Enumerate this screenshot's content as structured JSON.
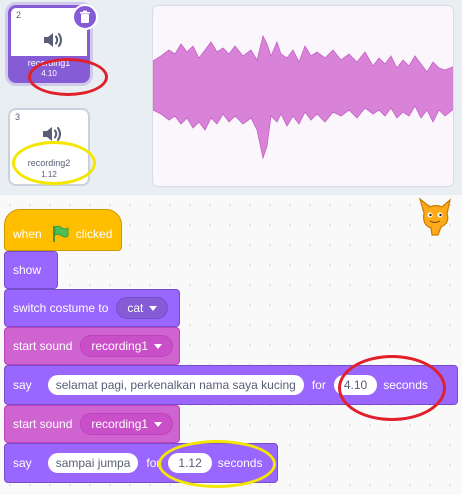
{
  "sounds": [
    {
      "number": "2",
      "name": "recording1",
      "duration": "4.10",
      "selected": true
    },
    {
      "number": "3",
      "name": "recording2",
      "duration": "1.12",
      "selected": false
    }
  ],
  "icons": {
    "speaker": "speaker-icon",
    "trash": "trash-icon",
    "flag": "green-flag-icon",
    "sprite": "scratch-cat-icon"
  },
  "colors": {
    "events": "#ffbf00",
    "looks": "#9966ff",
    "sound": "#cf63cf",
    "waveform": "#d883d8",
    "highlight_red": "#e0202a",
    "highlight_yellow": "#f5e600"
  },
  "script": {
    "hat": {
      "when": "when",
      "clicked": "clicked"
    },
    "show": {
      "label": "show"
    },
    "switch_costume": {
      "label": "switch costume to",
      "value": "cat"
    },
    "start_sound_1": {
      "label": "start sound",
      "value": "recording1"
    },
    "say_1": {
      "say": "say",
      "message": "selamat pagi, perkenalkan nama saya kucing",
      "for": "for",
      "seconds_value": "4.10",
      "seconds": "seconds"
    },
    "start_sound_2": {
      "label": "start sound",
      "value": "recording1"
    },
    "say_2": {
      "say": "say",
      "message": "sampai jumpa",
      "for": "for",
      "seconds_value": "1.12",
      "seconds": "seconds"
    }
  }
}
